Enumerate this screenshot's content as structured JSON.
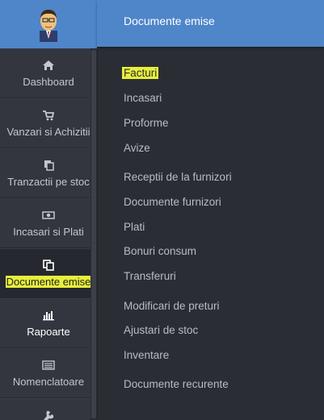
{
  "header": {
    "title": "Documente emise"
  },
  "sidebar": {
    "items": [
      {
        "label": "Dashboard",
        "icon": "home-icon"
      },
      {
        "label": "Vanzari si Achizitii",
        "icon": "cart-icon"
      },
      {
        "label": "Tranzactii pe stoc",
        "icon": "copy-documents-icon"
      },
      {
        "label": "Incasari si Plati",
        "icon": "banknote-icon"
      },
      {
        "label": "Documente emise",
        "icon": "documents-icon",
        "active": true
      },
      {
        "label": "Rapoarte",
        "icon": "bar-chart-icon"
      },
      {
        "label": "Nomenclatoare",
        "icon": "list-icon"
      },
      {
        "label": "",
        "icon": "wrench-icon"
      }
    ]
  },
  "submenu": {
    "items": [
      "Facturi",
      "Incasari",
      "Proforme",
      "Avize",
      "Receptii de la furnizori",
      "Documente furnizori",
      "Plati",
      "Bonuri consum",
      "Transferuri",
      "Modificari de preturi",
      "Ajustari de stoc",
      "Inventare",
      "Documente recurente"
    ]
  },
  "colors": {
    "accent": "#4e86c9",
    "sidebar_bg": "#33363f",
    "main_bg": "#2b2d35",
    "highlight": "#e8ef3a"
  }
}
